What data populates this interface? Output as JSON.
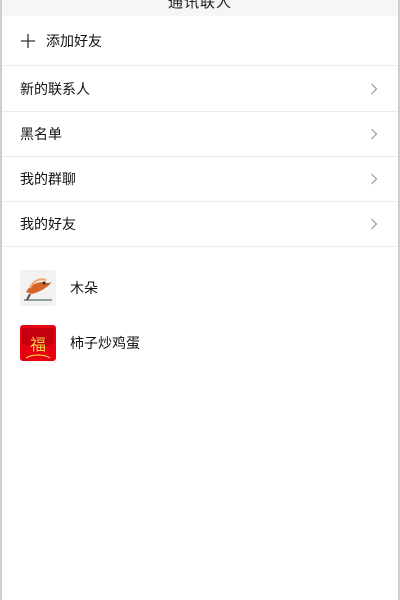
{
  "header": {
    "title": "通讯联人"
  },
  "menu": {
    "add_friend": "添加好友",
    "items": [
      {
        "label": "新的联系人"
      },
      {
        "label": "黑名单"
      },
      {
        "label": "我的群聊"
      },
      {
        "label": "我的好友"
      }
    ]
  },
  "friends": [
    {
      "name": "木朵",
      "avatar": "bird-avatar-icon"
    },
    {
      "name": "柿子炒鸡蛋",
      "avatar": "red-fu-envelope-icon",
      "avatar_text": "福"
    }
  ],
  "colors": {
    "divider": "#ececec",
    "chevron": "#9a9a9a",
    "accent_red": "#e60012",
    "fu_gold": "#f4d03f"
  }
}
